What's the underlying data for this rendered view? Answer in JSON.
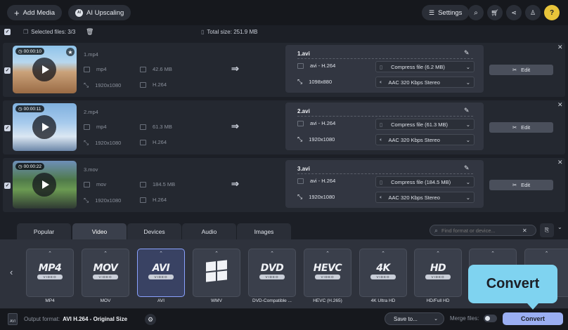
{
  "toolbar": {
    "add_media": "Add Media",
    "ai_upscaling": "AI Upscaling",
    "settings": "Settings"
  },
  "selection": {
    "selected_files": "Selected files: 3/3",
    "total_size": "Total size: 251.9 MB"
  },
  "files": [
    {
      "duration": "00:00:10",
      "name": "1.mp4",
      "container": "mp4",
      "size": "42.6 MB",
      "resolution": "1920x1080",
      "codec": "H.264",
      "out_name": "1.avi",
      "out_format": "avi - H.264",
      "out_resolution": "1098x880",
      "compress": "Compress file (6.2 MB)",
      "audio": "AAC 320 Kbps Stereo",
      "edit": "Edit"
    },
    {
      "duration": "00:00:11",
      "name": "2.mp4",
      "container": "mp4",
      "size": "61.3 MB",
      "resolution": "1920x1080",
      "codec": "H.264",
      "out_name": "2.avi",
      "out_format": "avi - H.264",
      "out_resolution": "1920x1080",
      "compress": "Compress file (61.3 MB)",
      "audio": "AAC 320 Kbps Stereo",
      "edit": "Edit"
    },
    {
      "duration": "00:00:22",
      "name": "3.mov",
      "container": "mov",
      "size": "184.5 MB",
      "resolution": "1920x1080",
      "codec": "H.264",
      "out_name": "3.avi",
      "out_format": "avi - H.264",
      "out_resolution": "1920x1080",
      "compress": "Compress file (184.5 MB)",
      "audio": "AAC 320 Kbps Stereo",
      "edit": "Edit"
    }
  ],
  "tabs": [
    "Popular",
    "Video",
    "Devices",
    "Audio",
    "Images"
  ],
  "active_tab": "Video",
  "search": {
    "placeholder": "Find format or device..."
  },
  "formats": [
    {
      "logo": "MP4",
      "label": "MP4"
    },
    {
      "logo": "MOV",
      "label": "MOV"
    },
    {
      "logo": "AVI",
      "label": "AVI"
    },
    {
      "logo": "",
      "label": "WMV"
    },
    {
      "logo": "DVD",
      "label": "DVD-Compatible ..."
    },
    {
      "logo": "HEVC",
      "label": "HEVC (H.265)"
    },
    {
      "logo": "4K",
      "label": "4K Ultra HD"
    },
    {
      "logo": "HD",
      "label": "HD/Full HD"
    }
  ],
  "format_sub": "VIDEO",
  "selected_format": "AVI",
  "footer": {
    "output_format_label": "Output format:",
    "output_format_value": "AVI H.264 - Original Size",
    "save_to": "Save to...",
    "merge_files": "Merge files:",
    "convert": "Convert"
  },
  "callout": {
    "text": "Convert"
  },
  "colors": {
    "accent": "#8aa2ff",
    "convert_button": "#9aaef2",
    "callout": "#7fd3f0"
  }
}
